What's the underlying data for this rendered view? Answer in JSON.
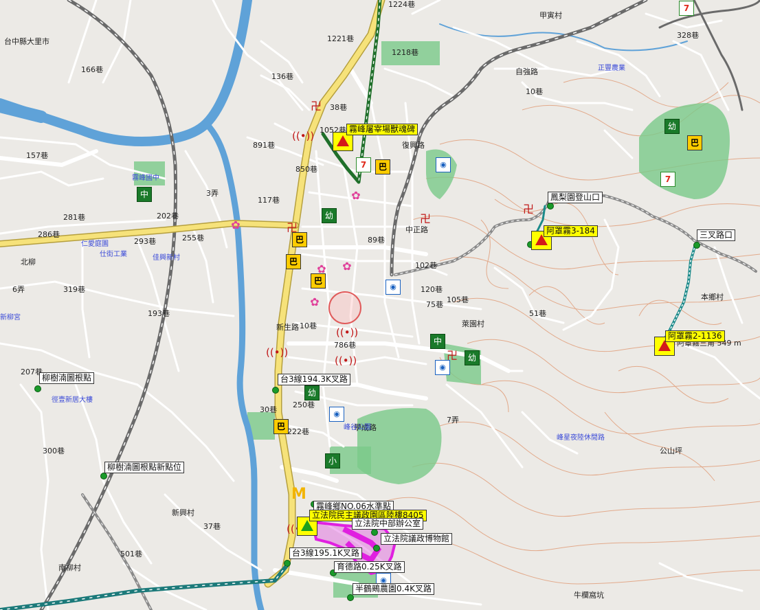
{
  "map": {
    "colors": {
      "background": "#eceae6",
      "river": "#5fa2d8",
      "provincial_highway": "#f6e27a",
      "highway_outline": "#b59f3e",
      "railway": "#8a8a8a",
      "track_green": "#1f6f2a",
      "track_teal": "#1c8a8a",
      "track_magenta": "#e020e0",
      "park": "#7ac98a",
      "contour": "#e2a98a"
    },
    "callouts": {
      "memorial": "霧峰屠宰場獸魂碑",
      "mt_point_3184": "阿罩霧3-184",
      "trailhead": "鳳梨園登山口",
      "junction": "三叉路口",
      "mt_point_21136": "阿罩霧2-1136",
      "liushukou_base": "柳樹湳圖根點",
      "liushukou_new": "柳樹湳圖根點新點位",
      "km_1943": "台3線194.3K叉路",
      "water_point": "霧峰鄉NO.06水準點",
      "legislative_park": "立法院民主議政園區陸樓8405",
      "office": "立法院中部辦公室",
      "museum": "立法院議政博物館",
      "km_1951": "台3線195.1K叉路",
      "yude_road": "育德路0.25K叉路",
      "farm": "半鶴鵐農園0.4K叉路"
    },
    "place_labels": {
      "taichung_dali": "台中縣大里市",
      "beiliu": "北柳",
      "xinliu": "新柳宮",
      "xinxing": "新興村",
      "nanliu": "南柳村",
      "ziqiang": "自強路",
      "jiatai": "甲寅村",
      "laiyuan": "萊園村",
      "benxiang": "本鄉村",
      "gongshan": "公山坪",
      "niujiaokeng": "牛欄窩坑",
      "zhengyuan": "正豐農業",
      "fengxian": "峰星夜陸休閒路",
      "wufeng_junior": "霧峰國中",
      "renai": "仁愛庭園",
      "shijia": "仕街工業",
      "jiaqing": "佳興新村",
      "xinsheng": "新生路",
      "xuecheng": "學成路",
      "zhongzheng": "中正路",
      "fuxing": "復興路",
      "pavilion": "峰谷公園",
      "xinxinge": "徑壹新居大樓",
      "ridge_note": "阿罩霧三角 549 m"
    },
    "road_labels": {
      "r1221": "1221巷",
      "r1218": "1218巷",
      "r1224": "1224巷",
      "r328": "328巷",
      "r891": "891巷",
      "r850": "850巷",
      "r202": "202巷",
      "r255": "255巷",
      "r293": "293巷",
      "r319": "319巷",
      "r286": "286巷",
      "r281": "281巷",
      "r166": "166巷",
      "r157": "157巷",
      "r193": "193巷",
      "r207": "207巷",
      "r300": "300巷",
      "r501": "501巷",
      "r37": "37巷",
      "r102": "102巷",
      "r120": "120巷",
      "r75": "75巷",
      "r105": "105巷",
      "r89": "89巷",
      "r10": "10巷",
      "r250": "250巷",
      "r222": "222巷",
      "r786": "786巷",
      "r10b": "10巷",
      "r3n": "3弄",
      "r6n": "6弄",
      "r7n": "7弄",
      "r51": "51巷",
      "r136": "136巷",
      "r117": "117巷",
      "r1052": "1052巷",
      "r38": "38巷",
      "r30": "30巷"
    },
    "icons": {
      "school": "中",
      "elementary": "小",
      "kindergarten": "幼",
      "bus": "巴",
      "camera": "◉",
      "temple": "卍",
      "flower": "✿",
      "seven": "7",
      "radio": "((•))",
      "mcdonalds": "M"
    }
  }
}
